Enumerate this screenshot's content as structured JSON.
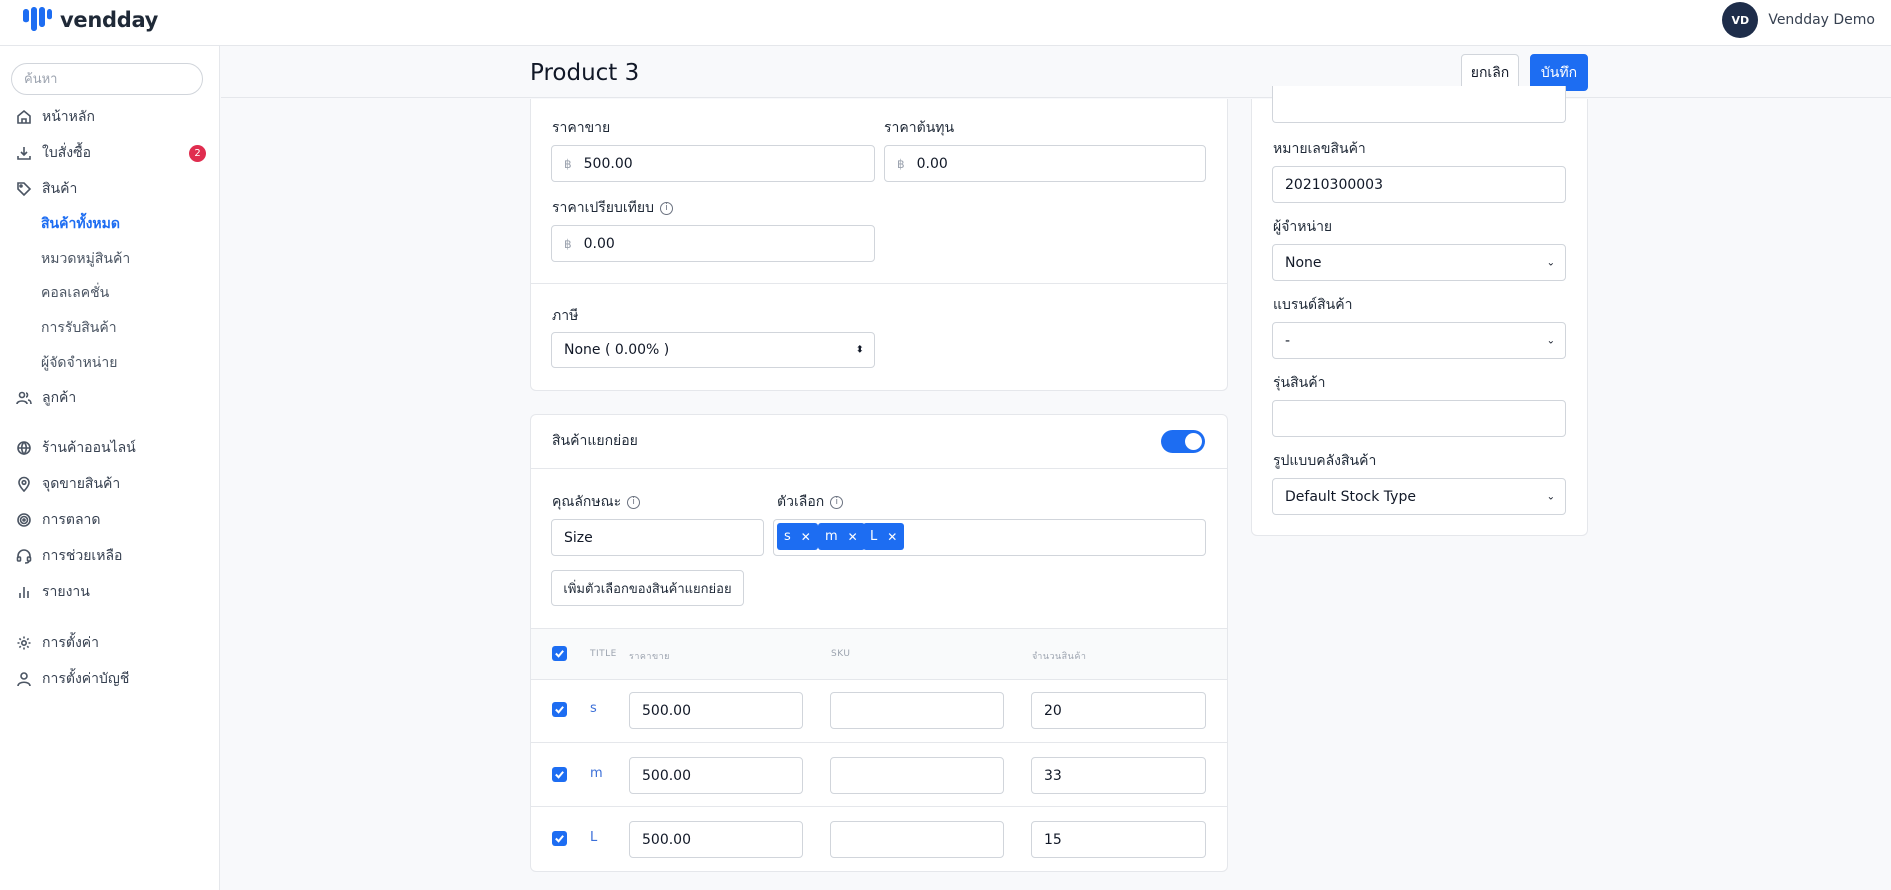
{
  "brand": {
    "name": "vendday",
    "accent": "#1d6df2"
  },
  "user": {
    "initials": "VD",
    "name": "Vendday Demo"
  },
  "search": {
    "placeholder": "ค้นหา"
  },
  "nav": {
    "home": "หน้าหลัก",
    "orders": "ใบสั่งซื้อ",
    "orders_badge": "2",
    "products": "สินค้า",
    "sub": {
      "all_products": "สินค้าทั้งหมด",
      "categories": "หมวดหมู่สินค้า",
      "collections": "คอลเลคชั่น",
      "receiving": "การรับสินค้า",
      "suppliers": "ผู้จัดจำหน่าย"
    },
    "customers": "ลูกค้า",
    "online_store": "ร้านค้าออนไลน์",
    "pos": "จุดขายสินค้า",
    "marketing": "การตลาด",
    "help": "การช่วยเหลือ",
    "reports": "รายงาน",
    "settings": "การตั้งค่า",
    "account_settings": "การตั้งค่าบัญชี"
  },
  "page": {
    "title": "Product 3",
    "cancel": "ยกเลิก",
    "save": "บันทึก"
  },
  "pricing": {
    "sell_price_label": "ราคาขาย",
    "sell_price_value": "500.00",
    "cost_price_label": "ราคาต้นทุน",
    "cost_price_value": "0.00",
    "compare_price_label": "ราคาเปรียบเทียบ",
    "compare_price_value": "0.00",
    "currency": "฿",
    "tax_label": "ภาษี",
    "tax_value": "None ( 0.00% )"
  },
  "variants": {
    "title": "สินค้าแยกย่อย",
    "enabled": true,
    "attribute_label": "คุณลักษณะ",
    "attribute_value": "Size",
    "options_label": "ตัวเลือก",
    "options": [
      "s",
      "m",
      "L"
    ],
    "add_option_button": "เพิ่มตัวเลือกของสินค้าแยกย่อย",
    "columns": {
      "title": "TITLE",
      "price": "ราคาขาย",
      "sku": "SKU",
      "qty": "จำนวนสินค้า"
    },
    "rows": [
      {
        "title": "s",
        "price": "500.00",
        "sku": "",
        "qty": "20"
      },
      {
        "title": "m",
        "price": "500.00",
        "sku": "",
        "qty": "33"
      },
      {
        "title": "L",
        "price": "500.00",
        "sku": "",
        "qty": "15"
      }
    ]
  },
  "side": {
    "product_number_label": "หมายเลขสินค้า",
    "product_number_value": "20210300003",
    "vendor_label": "ผู้จำหน่าย",
    "vendor_value": "None",
    "brand_label": "แบรนด์สินค้า",
    "brand_value": "-",
    "model_label": "รุ่นสินค้า",
    "model_value": "",
    "stock_type_label": "รูปแบบคลังสินค้า",
    "stock_type_value": "Default Stock Type"
  }
}
